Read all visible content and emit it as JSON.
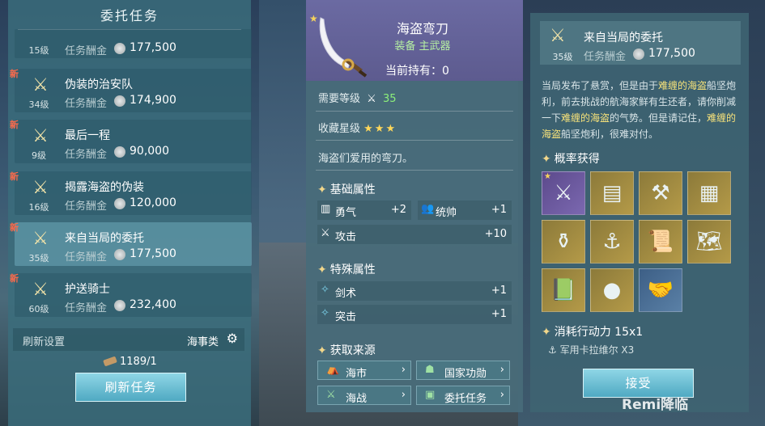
{
  "left_panel": {
    "title": "委托任务",
    "missions": [
      {
        "is_new": false,
        "new_label": "",
        "level": "15级",
        "name": "",
        "reward_label": "任务酬金",
        "reward": "177,500"
      },
      {
        "is_new": true,
        "new_label": "新",
        "level": "34级",
        "name": "伪装的治安队",
        "reward_label": "任务酬金",
        "reward": "174,900"
      },
      {
        "is_new": true,
        "new_label": "新",
        "level": "9级",
        "name": "最后一程",
        "reward_label": "任务酬金",
        "reward": "90,000"
      },
      {
        "is_new": true,
        "new_label": "新",
        "level": "16级",
        "name": "揭露海盗的伪装",
        "reward_label": "任务酬金",
        "reward": "120,000"
      },
      {
        "is_new": true,
        "new_label": "新",
        "level": "35级",
        "name": "来自当局的委托",
        "reward_label": "任务酬金",
        "reward": "177,500"
      },
      {
        "is_new": true,
        "new_label": "新",
        "level": "60级",
        "name": "护送骑士",
        "reward_label": "任务酬金",
        "reward": "232,400"
      }
    ],
    "refresh_settings_label": "刷新设置",
    "refresh_category": "海事类",
    "ticket_count": "1189/1",
    "refresh_button": "刷新任务"
  },
  "item_card": {
    "name": "海盗弯刀",
    "type": "装备 主武器",
    "held_label": "当前持有：",
    "held_value": "0",
    "req_label": "需要等级",
    "req_value": "35",
    "rarity_label": "收藏星级",
    "rarity_stars": "★★★",
    "flavor": "海盗们爱用的弯刀。",
    "base_attr_title": "基础属性",
    "base_attrs": [
      {
        "name": "勇气",
        "value": "+2"
      },
      {
        "name": "统帅",
        "value": "+1"
      },
      {
        "name": "攻击",
        "value": "+10"
      }
    ],
    "special_attr_title": "特殊属性",
    "special_attrs": [
      {
        "name": "剑术",
        "value": "+1"
      },
      {
        "name": "突击",
        "value": "+1"
      }
    ],
    "source_title": "获取来源",
    "sources": [
      {
        "label": "海市"
      },
      {
        "label": "国家功勋"
      },
      {
        "label": "海战"
      },
      {
        "label": "委托任务"
      }
    ]
  },
  "detail_panel": {
    "level": "35级",
    "name": "来自当局的委托",
    "reward_label": "任务酬金",
    "reward": "177,500",
    "desc_parts": [
      "当局发布了悬赏，但是由于",
      "难缠的海盗",
      "船坚炮利，前去挑战的航海家鲜有生还者，请你削减一下",
      "难缠的海盗",
      "的气势。但是请记住，",
      "难缠的海盗",
      "船坚炮利，很难对付。"
    ],
    "drop_title": "概率获得",
    "consume_title": "消耗行动力 15x1",
    "consume_item": "军用卡拉维尔 X3",
    "accept_button": "接受"
  },
  "watermark": "Remi降临"
}
